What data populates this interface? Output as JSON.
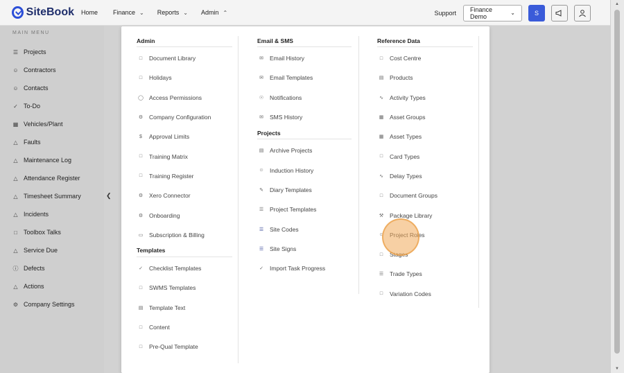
{
  "brand": {
    "name": "SiteBook",
    "color": "#2c4fd8"
  },
  "topnav": {
    "home": "Home",
    "finance": "Finance",
    "reports": "Reports",
    "admin": "Admin",
    "support": "Support",
    "org": "Finance Demo",
    "avatar_initial": "S"
  },
  "sidebar": {
    "title": "MAIN MENU",
    "items": [
      {
        "label": "Projects",
        "icon": "list-icon"
      },
      {
        "label": "Contractors",
        "icon": "people-icon"
      },
      {
        "label": "Contacts",
        "icon": "people-icon"
      },
      {
        "label": "To-Do",
        "icon": "check-icon"
      },
      {
        "label": "Vehicles/Plant",
        "icon": "truck-icon"
      },
      {
        "label": "Faults",
        "icon": "warning-icon"
      },
      {
        "label": "Maintenance Log",
        "icon": "warning-icon"
      },
      {
        "label": "Attendance Register",
        "icon": "warning-icon"
      },
      {
        "label": "Timesheet Summary",
        "icon": "warning-icon"
      },
      {
        "label": "Incidents",
        "icon": "warning-icon"
      },
      {
        "label": "Toolbox Talks",
        "icon": "chat-icon"
      },
      {
        "label": "Service Due",
        "icon": "warning-icon"
      },
      {
        "label": "Defects",
        "icon": "alert-circle-icon"
      },
      {
        "label": "Actions",
        "icon": "warning-icon"
      },
      {
        "label": "Company Settings",
        "icon": "gear-icon"
      }
    ]
  },
  "admin_menu": {
    "admin": {
      "title": "Admin",
      "items": [
        "Document Library",
        "Holidays",
        "Access Permissions",
        "Company Configuration",
        "Approval Limits",
        "Training Matrix",
        "Training Register",
        "Xero Connector",
        "Onboarding",
        "Subscription & Billing"
      ]
    },
    "templates": {
      "title": "Templates",
      "items": [
        "Checklist Templates",
        "SWMS Templates",
        "Template Text",
        "Content",
        "Pre-Qual Template"
      ]
    },
    "email_sms": {
      "title": "Email & SMS",
      "items": [
        "Email History",
        "Email Templates",
        "Notifications",
        "SMS History"
      ]
    },
    "projects": {
      "title": "Projects",
      "items": [
        "Archive Projects",
        "Induction History",
        "Diary Templates",
        "Project Templates",
        "Site Codes",
        "Site Signs",
        "Import Task Progress"
      ]
    },
    "reference": {
      "title": "Reference Data",
      "items": [
        "Cost Centre",
        "Products",
        "Activity Types",
        "Asset Groups",
        "Asset Types",
        "Card Types",
        "Delay Types",
        "Document Groups",
        "Package Library",
        "Project Roles",
        "Stages",
        "Trade Types",
        "Variation Codes"
      ]
    }
  }
}
